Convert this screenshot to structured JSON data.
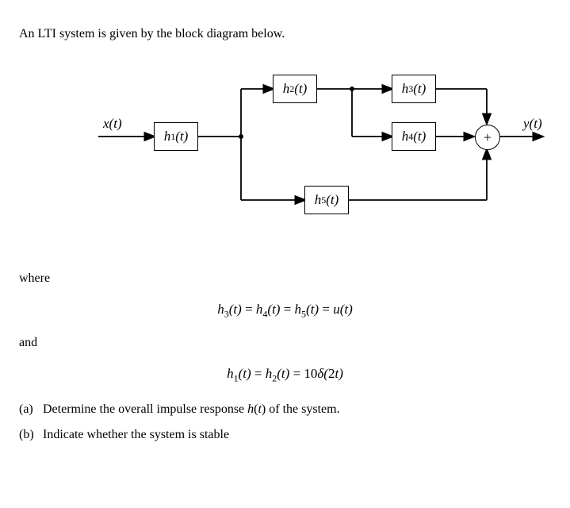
{
  "intro": "An LTI system is given by the block diagram below.",
  "signals": {
    "input": "x(t)",
    "output": "y(t)"
  },
  "blocks": {
    "h1": "h1(t)",
    "h2": "h2(t)",
    "h3": "h3(t)",
    "h4": "h4(t)",
    "h5": "h5(t)"
  },
  "sum": "+",
  "where": "where",
  "eq1": "h3(t) = h4(t) = h5(t) = u(t)",
  "and": "and",
  "eq2": "h1(t) = h2(t) = 10δ(2t)",
  "parts": {
    "a": {
      "label": "(a)",
      "text": "Determine the overall impulse response h(t) of the system."
    },
    "b": {
      "label": "(b)",
      "text": "Indicate whether the system is stable"
    }
  },
  "diagram_topology": {
    "description": "x -> h1 -> split; branch1 -> h2 -> split2 (-> h3 -> sum; -> h4 -> sum); branch2 -> h5 -> sum; sum -> y",
    "nodes": [
      "x",
      "h1",
      "split1",
      "h2",
      "split2",
      "h3",
      "h4",
      "h5",
      "sum",
      "y"
    ],
    "edges": [
      [
        "x",
        "h1"
      ],
      [
        "h1",
        "split1"
      ],
      [
        "split1",
        "h2"
      ],
      [
        "split1",
        "h5"
      ],
      [
        "h2",
        "split2"
      ],
      [
        "split2",
        "h3"
      ],
      [
        "split2",
        "h4"
      ],
      [
        "h3",
        "sum"
      ],
      [
        "h4",
        "sum"
      ],
      [
        "h5",
        "sum"
      ],
      [
        "sum",
        "y"
      ]
    ]
  }
}
